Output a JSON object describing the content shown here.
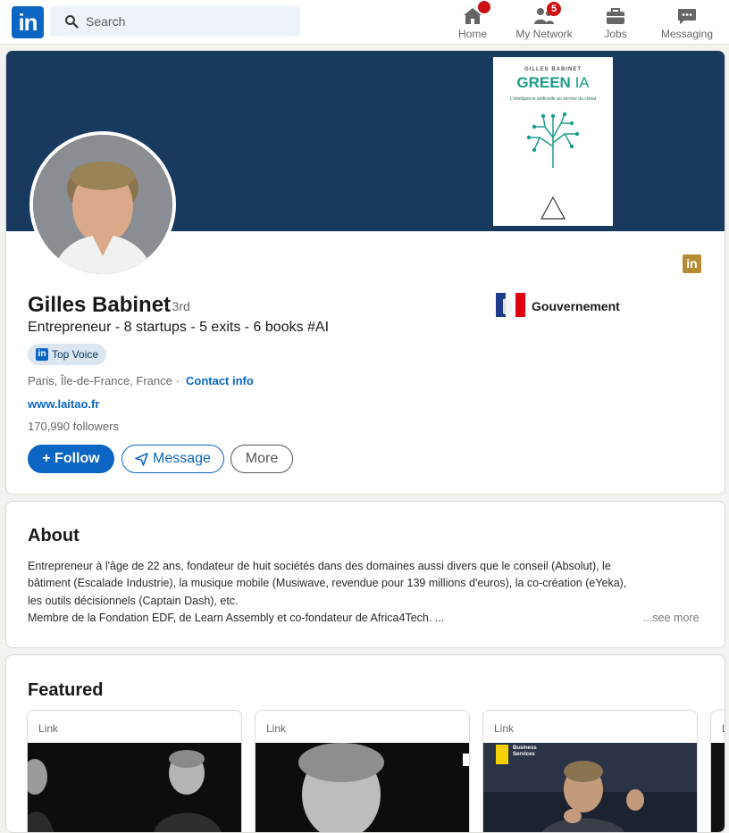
{
  "nav": {
    "logo_text": "in",
    "search_placeholder": "Search",
    "items": [
      {
        "label": "Home",
        "icon": "home-icon"
      },
      {
        "label": "My Network",
        "icon": "people-icon",
        "badge": "5"
      },
      {
        "label": "Jobs",
        "icon": "briefcase-icon"
      },
      {
        "label": "Messaging",
        "icon": "chat-icon"
      }
    ]
  },
  "banner": {
    "book": {
      "author": "GILLES BABINET",
      "title_green": "GREEN",
      "title_ia": "IA",
      "subtitle": "L'intelligence artificielle au service du climat",
      "publisher": "Odile Jacob"
    }
  },
  "profile": {
    "name": "Gilles Babinet",
    "degree": "· 3rd",
    "headline": "Entrepreneur - 8 startups - 5 exits - 6 books #AI",
    "badge": "Top Voice",
    "location": "Paris, Île-de-France, France ·",
    "contact_info": "Contact info",
    "website": "www.laitao.fr",
    "followers": "170,990 followers",
    "organization": "Gouvernement",
    "buttons": {
      "follow": "+ Follow",
      "message": "Message",
      "more": "More"
    }
  },
  "about": {
    "title": "About",
    "lines": [
      "Entrepreneur à l'âge de 22 ans, fondateur de huit sociétés dans des domaines aussi divers que le conseil (Absolut), le",
      "bâtiment (Escalade Industrie), la musique mobile (Musiwave, revendue pour 139 millions d'euros), la co-création (eYeka),",
      "les outils décisionnels (Captain Dash), etc.",
      "Membre de la Fondation EDF, de Learn Assembly et co-fondateur de Africa4Tech. ..."
    ],
    "see_more": "...see more"
  },
  "featured": {
    "title": "Featured",
    "items": [
      {
        "label": "Link"
      },
      {
        "label": "Link"
      },
      {
        "label": "Link",
        "overlay": "Business Services"
      },
      {
        "label": "L"
      }
    ]
  },
  "colors": {
    "brand": "#0a66c2",
    "banner": "#173a5e",
    "badge": "#cc1016",
    "background": "#f3f2ef"
  }
}
